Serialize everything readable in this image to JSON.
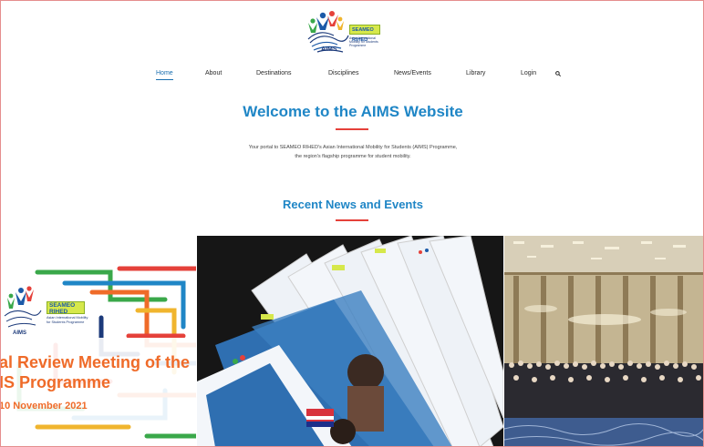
{
  "logo": {
    "badge": "SEAMEO RIHED",
    "subtitle": "Asian International Mobility for Students Programme",
    "name": "AIMS"
  },
  "nav": {
    "items": [
      "Home",
      "About",
      "Destinations",
      "Disciplines",
      "News/Events",
      "Library",
      "Login"
    ],
    "active": "Home",
    "search_icon": "search-icon"
  },
  "welcome": {
    "title": "Welcome to the AIMS Website",
    "intro_line1": "Your portal to SEAMEO RIHED's Asian International Mobility for Students (AIMS) Programme,",
    "intro_line2": "the region's flagship programme for student mobility."
  },
  "news": {
    "title": "Recent News and Events",
    "cards": [
      {
        "logo_badge": "SEAMEO RIHED",
        "logo_subtitle": "Asian International Mobility for Students Programme",
        "logo_name": "AIMS",
        "title_line1": "al Review Meeting of the",
        "title_line2": "IS Programme",
        "date": "10 November 2021"
      },
      {
        "image": "aims-brochures-photo"
      },
      {
        "image": "conference-group-photo"
      }
    ]
  },
  "colors": {
    "accent": "#1f86c6",
    "rule": "#e5413a",
    "card_text": "#ef6b29",
    "frame_border": "#e58e8e"
  }
}
